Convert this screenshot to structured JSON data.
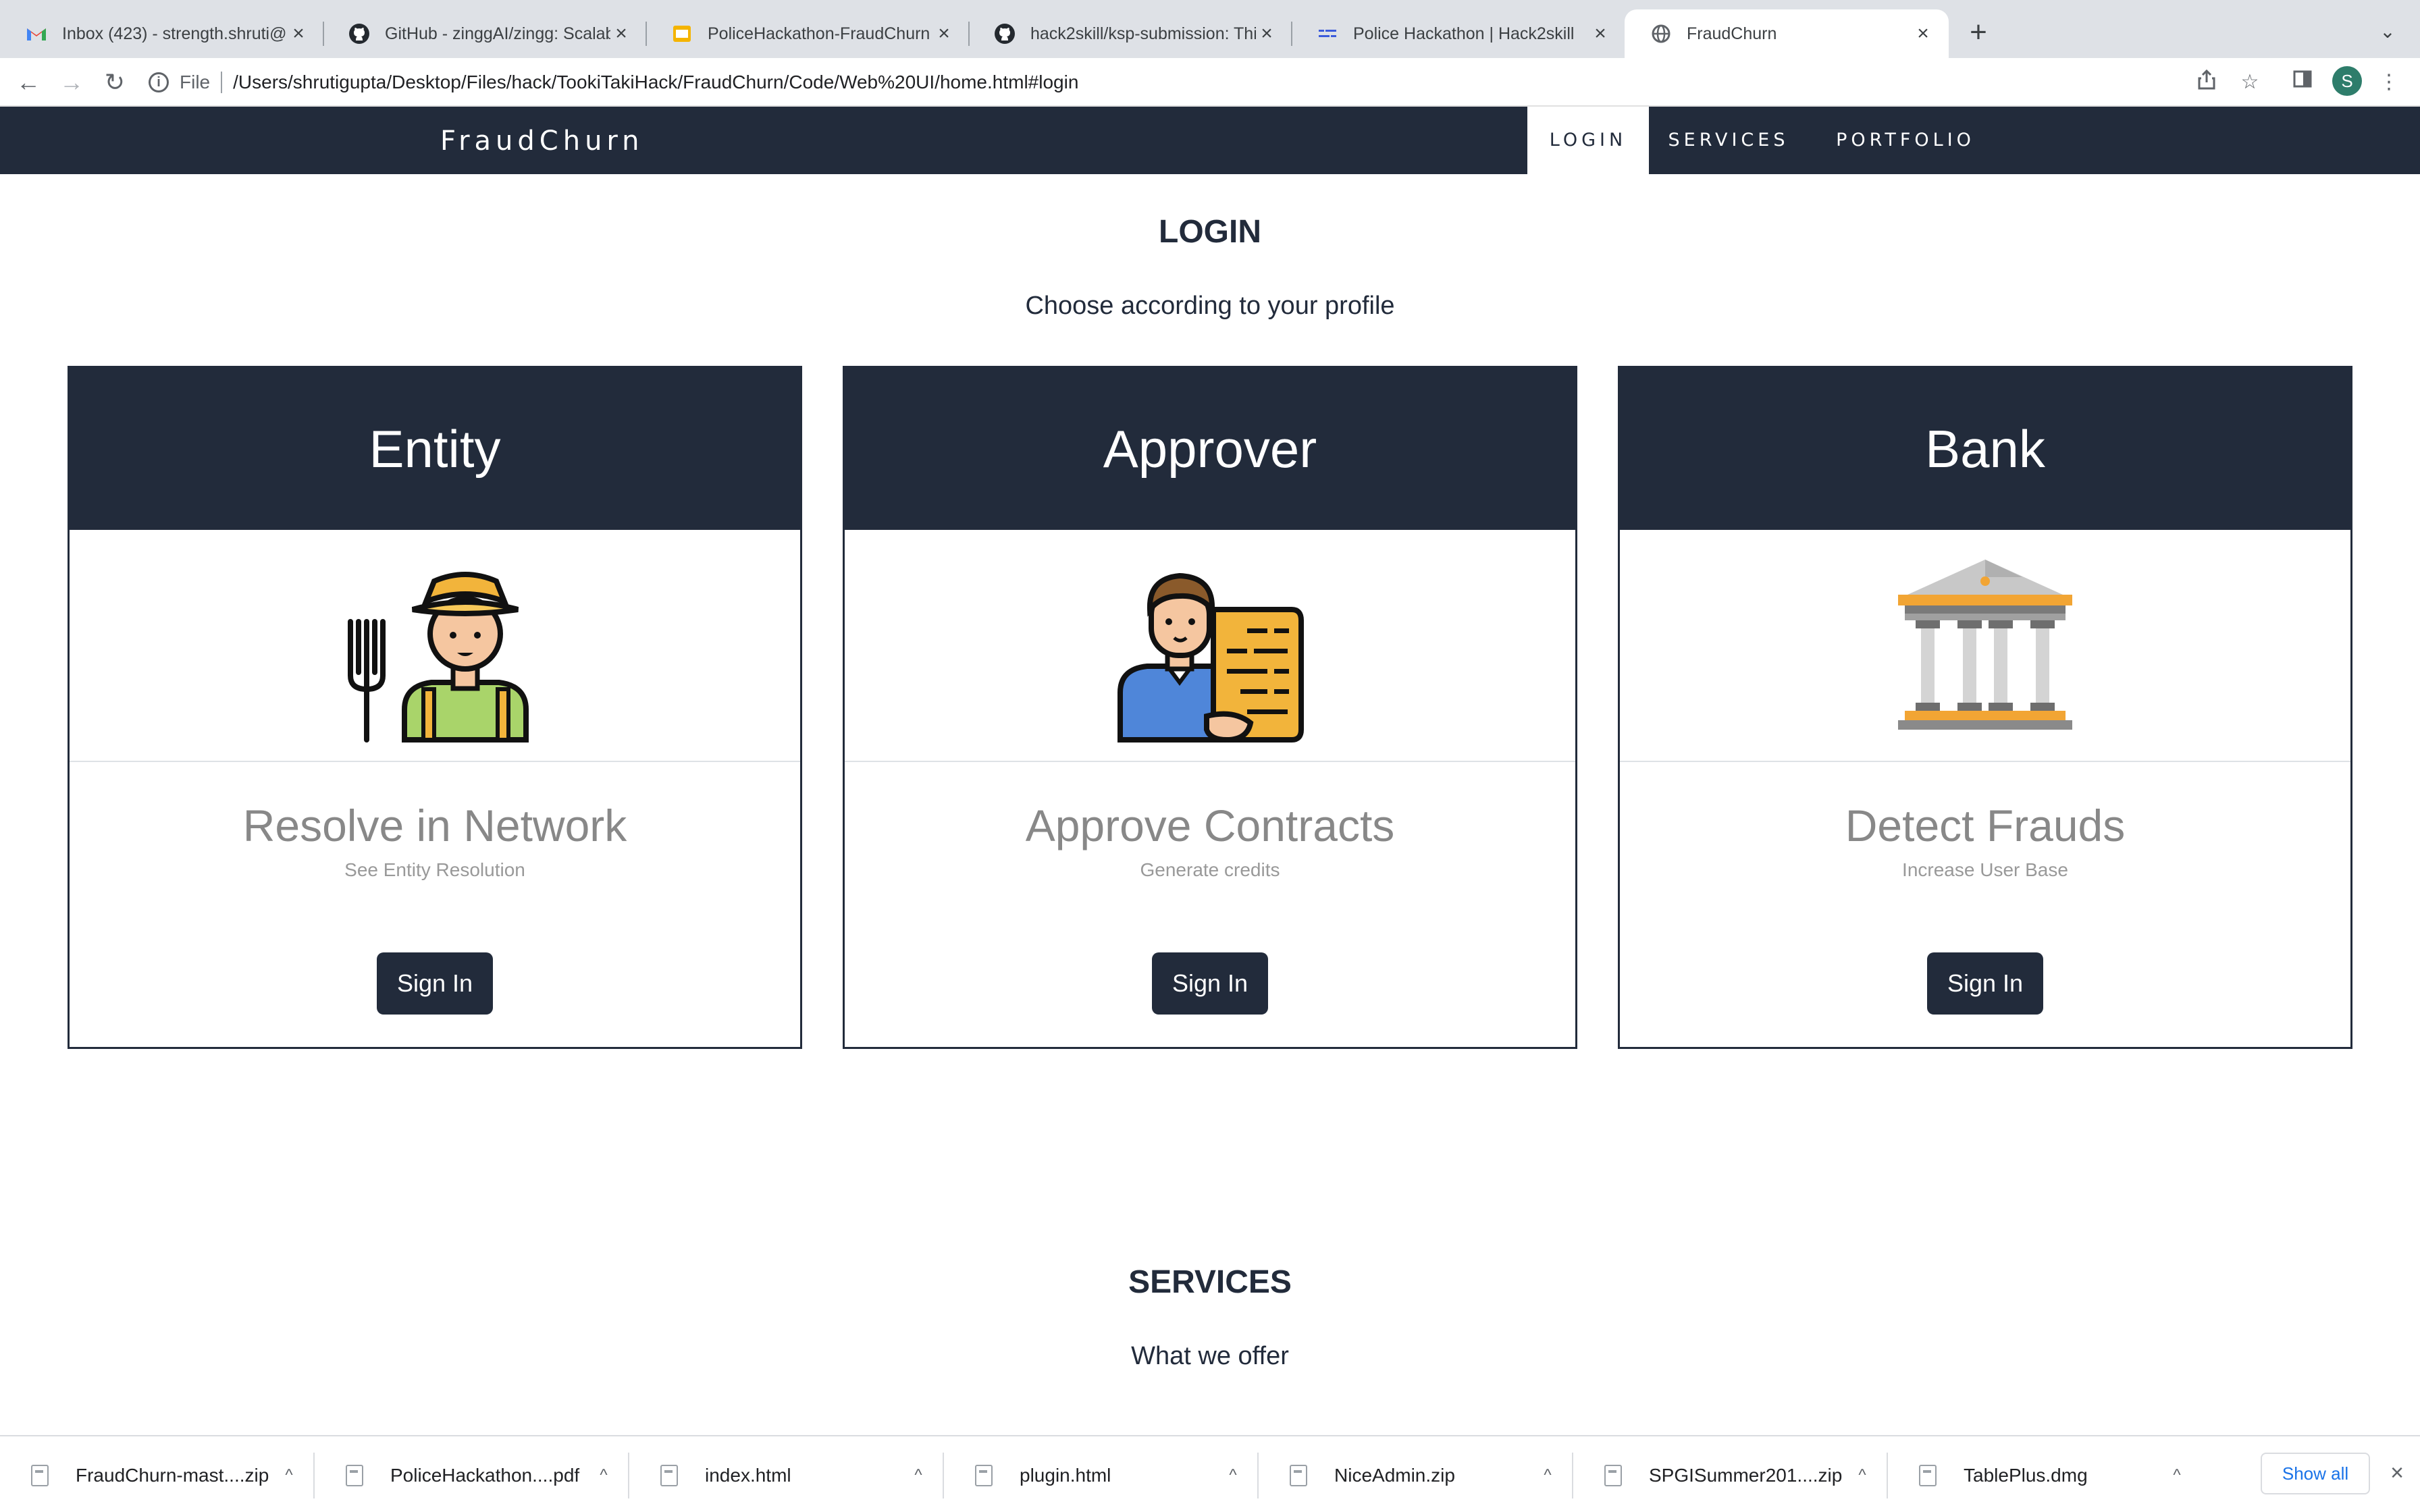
{
  "browser": {
    "tabs": [
      {
        "title": "Inbox (423) - strength.shruti@",
        "icon": "gmail-icon"
      },
      {
        "title": "GitHub - zinggAI/zingg: Scalab",
        "icon": "github-icon"
      },
      {
        "title": "PoliceHackathon-FraudChurn",
        "icon": "slides-icon"
      },
      {
        "title": "hack2skill/ksp-submission: Thi",
        "icon": "github-icon"
      },
      {
        "title": "Police Hackathon | Hack2skill",
        "icon": "hack2skill-icon"
      },
      {
        "title": "FraudChurn",
        "icon": "globe-icon"
      }
    ],
    "address": {
      "scheme_label": "File",
      "url": "/Users/shrutigupta/Desktop/Files/hack/TookiTakiHack/FraudChurn/Code/Web%20UI/home.html#login"
    },
    "profile_initial": "S"
  },
  "site": {
    "brand": "FraudChurn",
    "nav": [
      "LOGIN",
      "SERVICES",
      "PORTFOLIO"
    ],
    "login": {
      "heading": "LOGIN",
      "subheading": "Choose according to your profile",
      "cards": [
        {
          "header": "Entity",
          "title": "Resolve in Network",
          "desc": "See Entity Resolution",
          "button": "Sign In",
          "icon": "farmer-icon"
        },
        {
          "header": "Approver",
          "title": "Approve Contracts",
          "desc": "Generate credits",
          "button": "Sign In",
          "icon": "approver-icon"
        },
        {
          "header": "Bank",
          "title": "Detect Frauds",
          "desc": "Increase User Base",
          "button": "Sign In",
          "icon": "bank-icon"
        }
      ]
    },
    "services": {
      "heading": "SERVICES",
      "subheading": "What we offer"
    }
  },
  "downloads": {
    "items": [
      "FraudChurn-mast....zip",
      "PoliceHackathon....pdf",
      "index.html",
      "plugin.html",
      "NiceAdmin.zip",
      "SPGISummer201....zip",
      "TablePlus.dmg"
    ],
    "show_all": "Show all"
  },
  "colors": {
    "navy": "#222b3b",
    "chrome_bg": "#dee1e6",
    "muted_text": "#888888"
  }
}
